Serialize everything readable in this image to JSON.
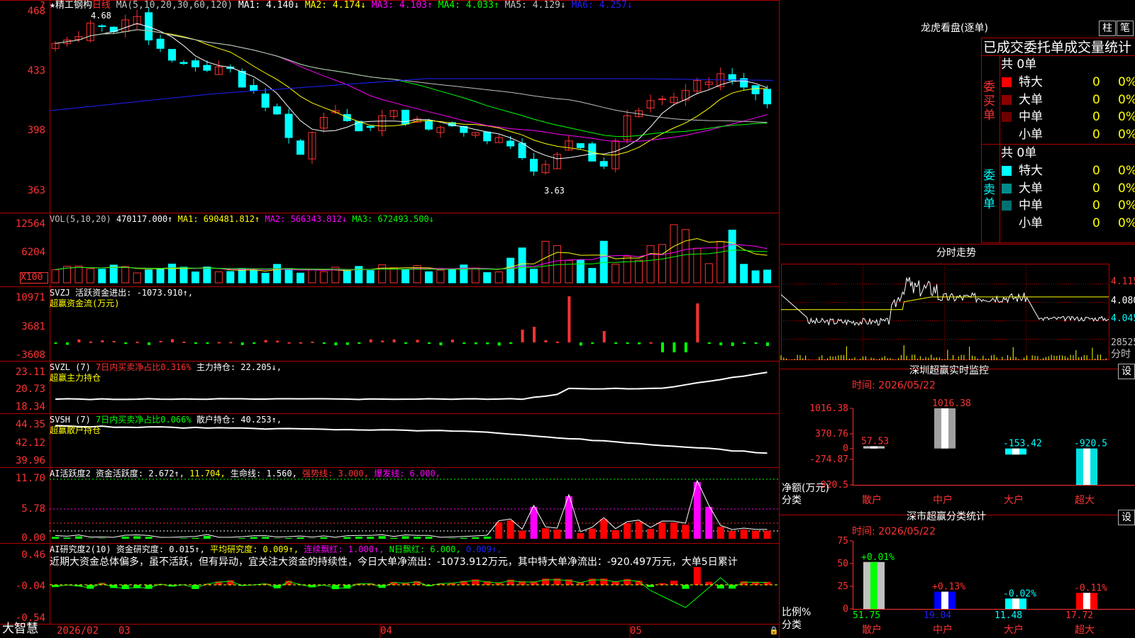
{
  "colors": {
    "up": "#ff3232",
    "down": "#00ffff",
    "grid": "#b00000",
    "ma1": "#ffffff",
    "ma2": "#ffff00",
    "ma3": "#ff00ff",
    "ma4": "#00ff00",
    "ma5": "#c0c0c0",
    "ma6": "#2020ff"
  },
  "header": {
    "star_icon": "star-icon",
    "stock_name": "精工钢构",
    "period": "日线",
    "ma_label": "MA(5,10,20,30,60,120)",
    "ma1": "MA1: 4.140↓",
    "ma2": "MA2: 4.174↓",
    "ma3": "MA3: 4.103↑",
    "ma4": "MA4: 4.033↑",
    "ma5": "MA5: 4.129↓",
    "ma6": "MA6: 4.257↓",
    "question": "?"
  },
  "price_axis": [
    "468",
    "433",
    "398",
    "363"
  ],
  "price_marks": {
    "high": "4.68",
    "low": "3.63"
  },
  "vol": {
    "label": "VOL(5,10,20)",
    "value": "470117.000↑",
    "ma1": "MA1: 690481.812↑",
    "ma2": "MA2: 566343.812↓",
    "ma3": "MA3: 672493.500↓",
    "axis": [
      "12564",
      "6204"
    ],
    "unit": "X100"
  },
  "svzj": {
    "label": "SVZJ  活跃资金进出: -1073.910↑,",
    "sub": "超赢资金流(万元)",
    "axis": [
      "10971",
      "3681",
      "-3608"
    ]
  },
  "svzl": {
    "label": "SVZL (7)",
    "red": "7日内买卖净占比0.316%",
    "main": "主力持仓: 22.205↓,",
    "sub": "超赢主力持仓",
    "axis": [
      "23.11",
      "20.73",
      "18.34"
    ]
  },
  "svsh": {
    "label": "SVSH (7)",
    "green": "7日内买卖净占比0.066%",
    "main": "散户持仓: 40.253↑,",
    "sub": "超赢散户持仓",
    "axis": [
      "44.35",
      "42.12",
      "39.96"
    ]
  },
  "ai_active": {
    "label": "AI活跃度2",
    "v1": "资金活跃度: 2.672↑,",
    "v2": "11.704,",
    "v3": "生命线: 1.560,",
    "v4": "强势线: 3.000,",
    "v5": "爆发线: 6.000,",
    "axis": [
      "11.70",
      "5.78",
      "0.00"
    ]
  },
  "ai_research": {
    "label": "AI研究度2(10)",
    "v1": "资金研究度: 0.015↑,",
    "v2": "平均研究度: 0.009↑,",
    "v3": "连续飘红: 1.000↑,",
    "v4": "N日飘红: 6.000,",
    "v5": "0.009↑,",
    "comment": "近期大资金总体偏多，虽不活跃，但有异动，宜关注大资金的持续性，今日大单净流出：-1073.912万元，其中特大单净流出：-920.497万元，大单5日累计",
    "axis": [
      "0.46",
      "-0.04",
      "-0.54"
    ]
  },
  "date_axis": {
    "brand": "大智慧",
    "labels": [
      "2026/02",
      "03",
      "04",
      "05"
    ]
  },
  "lhk": {
    "title": "龙虎看盘(逐单)",
    "btn1": "柱",
    "btn2": "笔",
    "tabs": "已成交委托单成交量统计",
    "buy_label": "委买单",
    "sell_label": "委卖单",
    "buy_total": "共 0单",
    "sell_total": "共 0单",
    "buy_rows": [
      {
        "name": "特大",
        "n": "0",
        "p": "0%",
        "color": "#ff0000"
      },
      {
        "name": "大单",
        "n": "0",
        "p": "0%",
        "color": "#8b0000"
      },
      {
        "name": "中单",
        "n": "0",
        "p": "0%",
        "color": "#6b0000"
      },
      {
        "name": "小单",
        "n": "0",
        "p": "0%",
        "color": "#000000"
      }
    ],
    "sell_rows": [
      {
        "name": "特大",
        "n": "0",
        "p": "0%",
        "color": "#00ffff"
      },
      {
        "name": "大单",
        "n": "0",
        "p": "0%",
        "color": "#008b8b"
      },
      {
        "name": "中单",
        "n": "0",
        "p": "0%",
        "color": "#007070"
      },
      {
        "name": "小单",
        "n": "0",
        "p": "0%",
        "color": "#000000"
      }
    ]
  },
  "fenshi": {
    "title": "分时走势",
    "axis": [
      "4.115",
      "4.080",
      "4.045"
    ],
    "vol": "28525",
    "vol_label": "分时"
  },
  "sz_monitor": {
    "title": "深圳超赢实时监控",
    "btn": "设",
    "time": "时间: 2026/05/22",
    "axis": [
      "1016.38",
      "370.76",
      "0",
      "-274.87",
      "-920.5"
    ],
    "ylabel": "净额(万元)",
    "xlabel": "分类",
    "categories": [
      "散户",
      "中户",
      "大户",
      "超大"
    ],
    "values_text": [
      "57.53",
      "1016.38",
      "-153.42",
      "-920.5"
    ]
  },
  "sz_class": {
    "title": "深市超赢分类统计",
    "btn": "设",
    "time": "时间: 2026/05/22",
    "axis": [
      "75",
      "50",
      "25",
      "0"
    ],
    "ylabel": "比例%",
    "xlabel": "分类",
    "categories": [
      "散户",
      "中户",
      "大户",
      "超大"
    ],
    "pct_text": [
      "+0.01%",
      "+0.13%",
      "-0.02%",
      "-0.11%"
    ],
    "values_text": [
      "51.75",
      "19.04",
      "11.48",
      "17.72"
    ]
  },
  "chart_data": [
    {
      "type": "bar",
      "title": "深圳超赢实时监控",
      "ylabel": "净额(万元)",
      "categories": [
        "散户",
        "中户",
        "大户",
        "超大"
      ],
      "values": [
        57.53,
        1016.38,
        -153.42,
        -920.5
      ],
      "ylim": [
        -920.5,
        1016.38
      ]
    },
    {
      "type": "bar",
      "title": "深市超赢分类统计",
      "ylabel": "比例%",
      "categories": [
        "散户",
        "中户",
        "大户",
        "超大"
      ],
      "values": [
        51.75,
        19.04,
        11.48,
        17.72
      ],
      "ylim": [
        0,
        75
      ]
    }
  ]
}
